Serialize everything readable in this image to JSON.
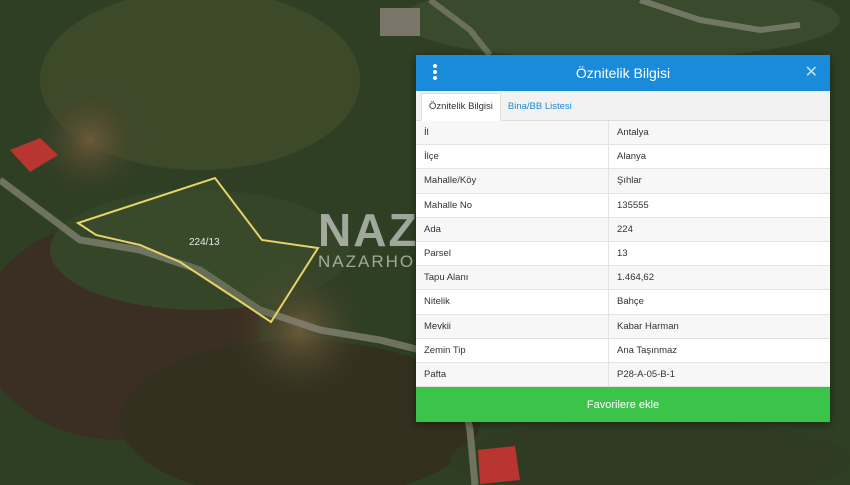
{
  "map": {
    "parcel_label": "224/13",
    "watermark_logo": "NAZ",
    "watermark_text": "NAZARHO"
  },
  "panel": {
    "title": "Öznitelik Bilgisi",
    "tabs": [
      {
        "label": "Öznitelik Bilgisi",
        "active": true
      },
      {
        "label": "Bina/BB Listesi",
        "active": false
      }
    ],
    "rows": [
      {
        "key": "İl",
        "value": "Antalya"
      },
      {
        "key": "İlçe",
        "value": "Alanya"
      },
      {
        "key": "Mahalle/Köy",
        "value": "Şıhlar"
      },
      {
        "key": "Mahalle No",
        "value": "135555"
      },
      {
        "key": "Ada",
        "value": "224"
      },
      {
        "key": "Parsel",
        "value": "13"
      },
      {
        "key": "Tapu Alanı",
        "value": "1.464,62"
      },
      {
        "key": "Nitelik",
        "value": "Bahçe"
      },
      {
        "key": "Mevkii",
        "value": "Kabar Harman"
      },
      {
        "key": "Zemin Tip",
        "value": "Ana Taşınmaz"
      },
      {
        "key": "Pafta",
        "value": "P28-A-05-B-1"
      }
    ],
    "button_label": "Favorilere ekle",
    "colors": {
      "header": "#1a8bd8",
      "button": "#3cc44a",
      "parcel_outline": "#e8d36a"
    }
  }
}
